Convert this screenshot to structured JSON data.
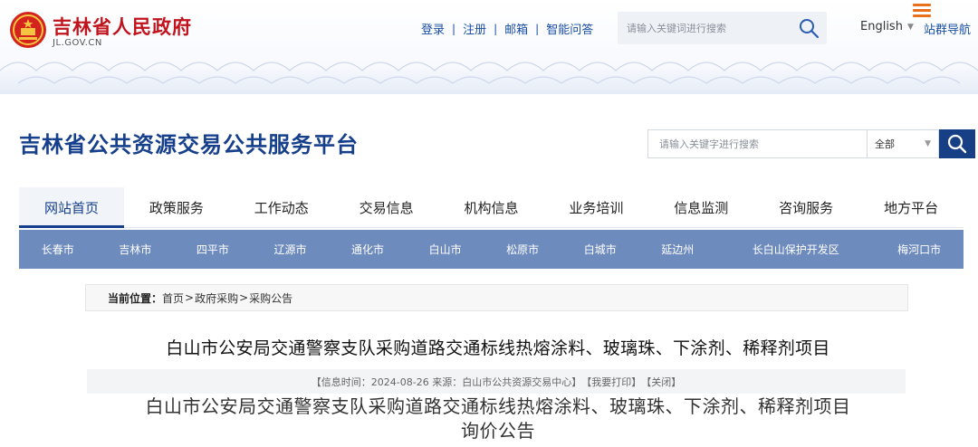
{
  "gov": {
    "title": "吉林省人民政府",
    "domain": "JL.GOV.CN",
    "links": [
      "登录",
      "注册",
      "邮箱",
      "智能问答"
    ],
    "search_placeholder": "请输入关键词进行搜索",
    "language": "English",
    "sitemap": "站群导航"
  },
  "platform": {
    "title": "吉林省公共资源交易公共服务平台",
    "search_placeholder": "请输入关键字进行搜索",
    "scope": "全部"
  },
  "main_nav": [
    "网站首页",
    "政策服务",
    "工作动态",
    "交易信息",
    "机构信息",
    "业务培训",
    "信息监测",
    "咨询服务",
    "地方平台"
  ],
  "city_nav": [
    "长春市",
    "吉林市",
    "四平市",
    "辽源市",
    "通化市",
    "白山市",
    "松原市",
    "白城市",
    "延边州",
    "长白山保护开发区",
    "梅河口市"
  ],
  "breadcrumb": {
    "label": "当前位置：",
    "items": [
      "首页",
      "政府采购",
      "采购公告"
    ]
  },
  "article": {
    "title": "白山市公安局交通警察支队采购道路交通标线热熔涂料、玻璃珠、下涂剂、稀释剂项目",
    "meta_info": "【信息时间：2024-08-26 来源：白山市公共资源交易中心】",
    "meta_print": "【我要打印】",
    "meta_close": "【关闭】",
    "announce_line1": "白山市公安局交通警察支队采购道路交通标线热熔涂料、玻璃珠、下涂剂、稀释剂项目",
    "announce_line2": "询价公告"
  },
  "colors": {
    "gov_red": "#c1131d",
    "brand_blue": "#163f8c",
    "city_bar": "#6e8bbd",
    "link_blue": "#1a4ea3",
    "menu_orange": "#e8701b"
  }
}
